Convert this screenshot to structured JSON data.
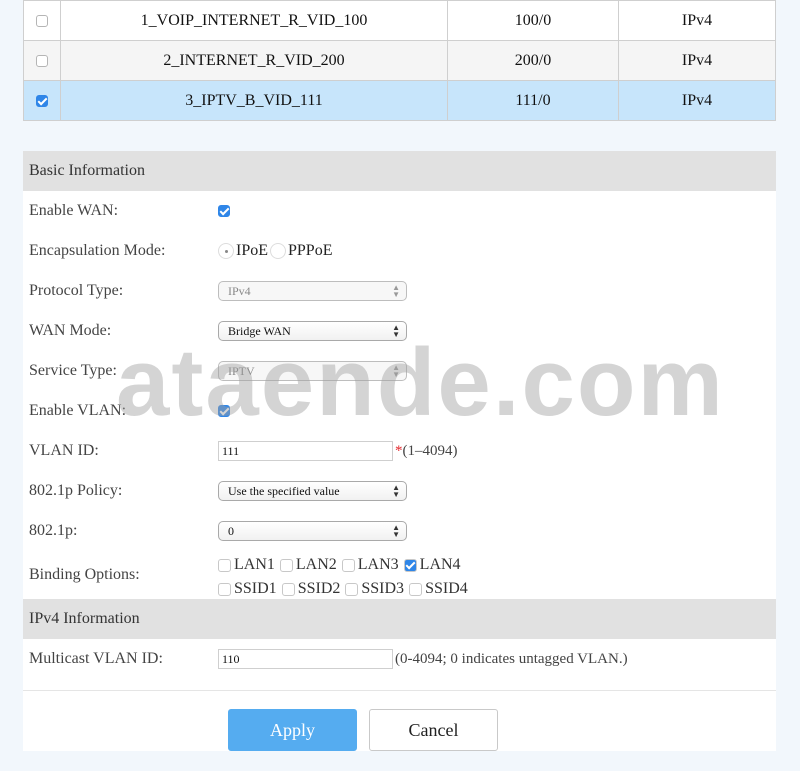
{
  "wan_list": {
    "rows": [
      {
        "checked": false,
        "name": "1_VOIP_INTERNET_R_VID_100",
        "vlan": "100/0",
        "protocol": "IPv4"
      },
      {
        "checked": false,
        "name": "2_INTERNET_R_VID_200",
        "vlan": "200/0",
        "protocol": "IPv4"
      },
      {
        "checked": true,
        "name": "3_IPTV_B_VID_111",
        "vlan": "111/0",
        "protocol": "IPv4"
      }
    ]
  },
  "basic": {
    "title": "Basic Information",
    "enable_wan": {
      "label": "Enable WAN:",
      "checked": true
    },
    "encapsulation": {
      "label": "Encapsulation Mode:",
      "options": [
        "IPoE",
        "PPPoE"
      ],
      "selected": "IPoE"
    },
    "protocol_type": {
      "label": "Protocol Type:",
      "value": "IPv4",
      "disabled": true
    },
    "wan_mode": {
      "label": "WAN Mode:",
      "value": "Bridge WAN"
    },
    "service_type": {
      "label": "Service Type:",
      "value": "IPTV",
      "disabled": true
    },
    "enable_vlan": {
      "label": "Enable VLAN:",
      "checked": true
    },
    "vlan_id": {
      "label": "VLAN ID:",
      "value": "111",
      "required_mark": "*",
      "hint": "(1–4094)"
    },
    "policy_8021p": {
      "label": "802.1p Policy:",
      "value": "Use the specified value"
    },
    "value_8021p": {
      "label": "802.1p:",
      "value": "0"
    },
    "binding": {
      "label": "Binding Options:",
      "lan": [
        {
          "name": "LAN1",
          "checked": false
        },
        {
          "name": "LAN2",
          "checked": false
        },
        {
          "name": "LAN3",
          "checked": false
        },
        {
          "name": "LAN4",
          "checked": true
        }
      ],
      "ssid": [
        {
          "name": "SSID1",
          "checked": false
        },
        {
          "name": "SSID2",
          "checked": false
        },
        {
          "name": "SSID3",
          "checked": false
        },
        {
          "name": "SSID4",
          "checked": false
        }
      ]
    }
  },
  "ipv4": {
    "title": "IPv4 Information",
    "multicast_vlan": {
      "label": "Multicast VLAN ID:",
      "value": "110",
      "hint": "(0-4094; 0 indicates untagged VLAN.)"
    }
  },
  "buttons": {
    "apply": "Apply",
    "cancel": "Cancel"
  },
  "watermark": "ataende.com",
  "colors": {
    "accent": "#2f86e8",
    "apply_button": "#55acf0",
    "selected_row": "#c7e5fb",
    "section_header": "#e1e1e1",
    "required": "#e3262b"
  }
}
